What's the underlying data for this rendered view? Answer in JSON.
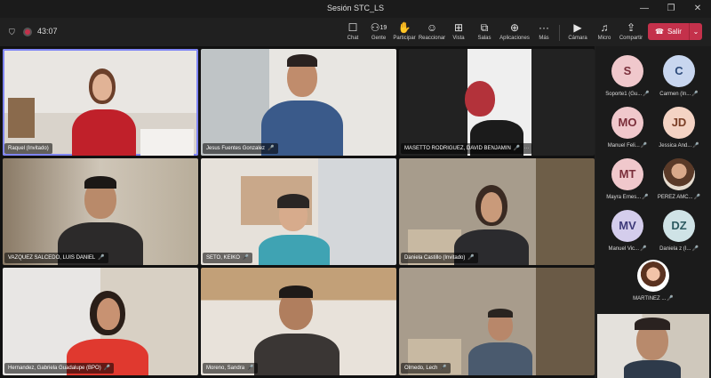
{
  "window": {
    "title": "Sesión STC_LS"
  },
  "toolbar": {
    "timer": "43:07",
    "buttons": [
      {
        "label": "Chat",
        "icon": "chat-icon",
        "glyph": "☐"
      },
      {
        "label": "Gente",
        "icon": "people-icon",
        "glyph": "👥",
        "count": "19"
      },
      {
        "label": "Participar",
        "icon": "raise-hand-icon",
        "glyph": "✋"
      },
      {
        "label": "Reaccionar",
        "icon": "react-icon",
        "glyph": "☺"
      },
      {
        "label": "Vista",
        "icon": "view-icon",
        "glyph": "⊞"
      },
      {
        "label": "Salas",
        "icon": "rooms-icon",
        "glyph": "⧉"
      },
      {
        "label": "Aplicaciones",
        "icon": "apps-icon",
        "glyph": "⊕"
      },
      {
        "label": "Más",
        "icon": "more-icon",
        "glyph": "···"
      },
      {
        "label": "Cámara",
        "icon": "camera-icon",
        "glyph": "■"
      },
      {
        "label": "Micro",
        "icon": "mic-icon",
        "glyph": "🎤"
      },
      {
        "label": "Compartir",
        "icon": "share-icon",
        "glyph": "⬆"
      }
    ],
    "leave_label": "Salir"
  },
  "tiles": [
    {
      "name": "Raquel (Invitado)",
      "mic": false,
      "more": false,
      "active": true
    },
    {
      "name": "Jesus Fuentes Gonzalez",
      "mic": true,
      "more": false,
      "active": false
    },
    {
      "name": "MASETTO RODRIGUEZ, DAVID BENJAMIN",
      "mic": true,
      "more": true,
      "active": false
    },
    {
      "name": "VAZQUEZ SALCEDO, LUIS DANIEL",
      "mic": true,
      "more": false,
      "active": false
    },
    {
      "name": "SETO, KEIKO",
      "mic": true,
      "more": false,
      "active": false
    },
    {
      "name": "Daniela Castillo (Invitado)",
      "mic": true,
      "more": false,
      "active": false
    },
    {
      "name": "Hernandez, Gabriela Guadalupe (BPO)",
      "mic": true,
      "more": false,
      "active": false
    },
    {
      "name": "Moreno, Sandra",
      "mic": true,
      "more": false,
      "active": false
    },
    {
      "name": "Olmedo, Lech",
      "mic": true,
      "more": false,
      "active": false
    }
  ],
  "side_participants": [
    {
      "initials": "S",
      "name": "Soporte1 (Gu...",
      "color": "#f0c8cc",
      "text_color": "#7a2e3a"
    },
    {
      "initials": "C",
      "name": "Carmen (In...",
      "color": "#c8d6ef",
      "text_color": "#2c4a7a"
    },
    {
      "initials": "MO",
      "name": "Manuel Feli...",
      "color": "#f0c8cc",
      "text_color": "#7a2e3a"
    },
    {
      "initials": "JD",
      "name": "Jessica And...",
      "color": "#f4d3c4",
      "text_color": "#7a3e26"
    },
    {
      "initials": "MT",
      "name": "Mayra Ernes...",
      "color": "#f0c8cc",
      "text_color": "#7a2e3a"
    },
    {
      "initials": "",
      "name": "PEREZ AMC...",
      "color": "#b89a84",
      "text_color": "#ffffff"
    },
    {
      "initials": "MV",
      "name": "Manuel Vic...",
      "color": "#d4cdec",
      "text_color": "#3e3a7a"
    },
    {
      "initials": "DZ",
      "name": "Daniela z (I...",
      "color": "#cfe3e6",
      "text_color": "#2c5a60"
    },
    {
      "initials": "",
      "name": "MARTINEZ ...",
      "color": "#ffffff",
      "text_color": "#333333"
    }
  ]
}
